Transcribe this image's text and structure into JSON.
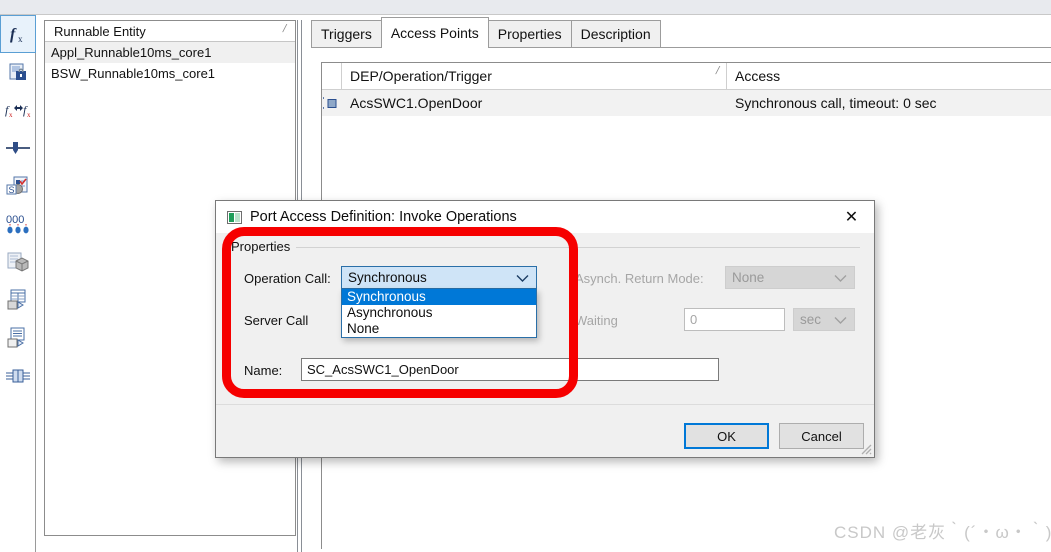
{
  "window": {
    "background_color": "#ffffff",
    "top_strip_color": "#e8eaee"
  },
  "toolbar": {
    "items": [
      {
        "name": "function-fx-icon",
        "tooltip": "Runnable Entities",
        "selected": true
      },
      {
        "name": "locked-document-icon",
        "tooltip": "Server Call Points",
        "selected": false
      },
      {
        "name": "fx-to-fx-icon",
        "tooltip": "Inter Runnable Variables",
        "selected": false
      },
      {
        "name": "slider-icon",
        "tooltip": "Exclusive Areas",
        "selected": false
      },
      {
        "name": "s-check-document-icon",
        "tooltip": "Per Instance Memory",
        "selected": false
      },
      {
        "name": "triple-zero-icon",
        "tooltip": "Constants",
        "selected": false
      },
      {
        "name": "package-document-icon",
        "tooltip": "Compositions",
        "selected": false
      },
      {
        "name": "table-transfer-icon",
        "tooltip": "Data Mappings",
        "selected": false
      },
      {
        "name": "list-transfer-icon",
        "tooltip": "Port Mappings",
        "selected": false
      },
      {
        "name": "connector-icon",
        "tooltip": "Connectors",
        "selected": false
      }
    ]
  },
  "tree_panel": {
    "header": "Runnable Entity",
    "sort_mark": "/",
    "rows": [
      {
        "label": "Appl_Runnable10ms_core1",
        "selected": true
      },
      {
        "label": "BSW_Runnable10ms_core1",
        "selected": false
      }
    ]
  },
  "tabs": [
    {
      "label": "Triggers",
      "active": false
    },
    {
      "label": "Access Points",
      "active": true
    },
    {
      "label": "Properties",
      "active": false
    },
    {
      "label": "Description",
      "active": false
    }
  ],
  "table": {
    "columns": [
      {
        "label": "DEP/Operation/Trigger",
        "sort_mark": "/"
      },
      {
        "label": "Access",
        "sort_mark": "/"
      }
    ],
    "rows": [
      {
        "icon": "server-call-point-icon",
        "operation": "AcsSWC1.OpenDoor",
        "access": "Synchronous call, timeout: 0 sec",
        "selected": true
      }
    ]
  },
  "dialog": {
    "title": "Port Access Definition: Invoke Operations",
    "title_icon": "green-square-icon",
    "close_label": "✕",
    "group_title": "Properties",
    "fields": {
      "operation_call_label": "Operation Call:",
      "operation_call_value": "Synchronous",
      "operation_call_options": [
        "Synchronous",
        "Asynchronous",
        "None"
      ],
      "operation_call_selected_index": 0,
      "server_call_label": "Server Call",
      "asynch_return_label": "Asynch. Return Mode:",
      "asynch_return_value": "None",
      "waiting_label": "Waiting",
      "waiting_value": "0",
      "waiting_unit": "sec",
      "name_label": "Name:",
      "name_value": "SC_AcsSWC1_OpenDoor"
    },
    "buttons": {
      "ok": "OK",
      "cancel": "Cancel"
    }
  },
  "annotation": {
    "color": "#f60000",
    "shape": "rounded-rectangle"
  },
  "watermark": {
    "text": "CSDN @老灰｀(´・ω・｀)｀"
  }
}
